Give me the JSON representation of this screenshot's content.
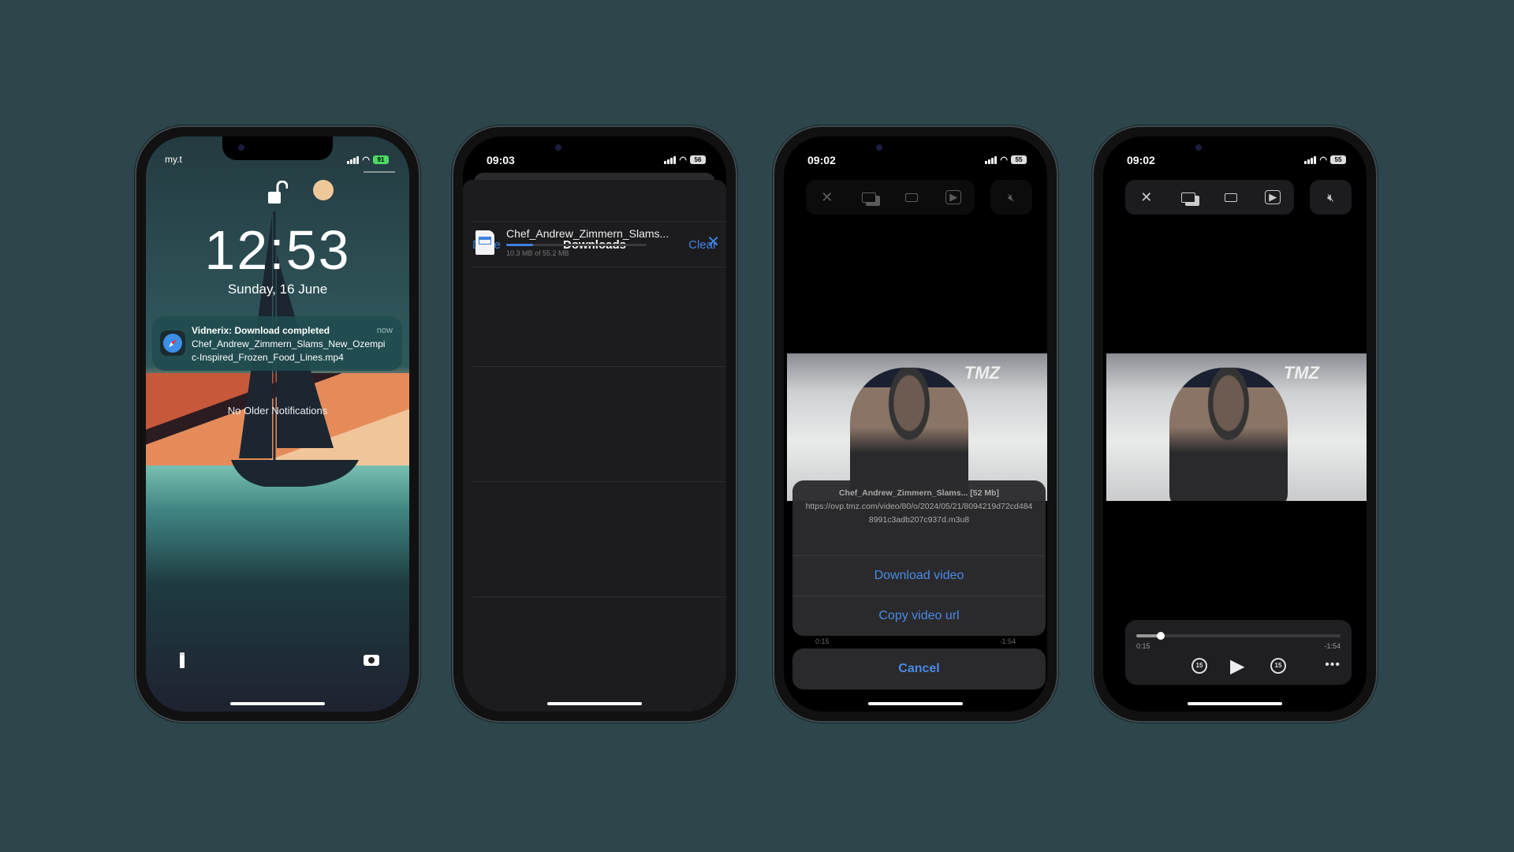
{
  "phone1": {
    "carrier": "my.t",
    "battery": "91",
    "time": "12:53",
    "date": "Sunday, 16 June",
    "notification": {
      "title": "Vidnerix: Download completed",
      "time": "now",
      "body": "Chef_Andrew_Zimmern_Slams_New_Ozempic-Inspired_Frozen_Food_Lines.mp4",
      "icon": "safari-compass-icon"
    },
    "no_older": "No Older Notifications"
  },
  "phone2": {
    "time": "09:03",
    "battery": "56",
    "done": "Done",
    "title": "Downloads",
    "clear": "Clear",
    "item": {
      "name": "Chef_Andrew_Zimmern_Slams...",
      "size": "10.3 MB of 55.2 MB",
      "progress": 0.19
    }
  },
  "phone3": {
    "time": "09:02",
    "battery": "55",
    "video_logo": "TMZ",
    "sheet": {
      "title": "Chef_Andrew_Zimmern_Slams... [52 Mb]",
      "url": "https://ovp.tmz.com/video/80/o/2024/05/21/8094219d72cd4848991c3adb207c937d.m3u8",
      "download": "Download video",
      "copy": "Copy video url",
      "cancel": "Cancel"
    },
    "behind_elapsed": "0:15",
    "behind_remaining": "-1:54"
  },
  "phone4": {
    "time": "09:02",
    "battery": "55",
    "video_logo": "TMZ",
    "elapsed": "0:15",
    "remaining": "-1:54",
    "progress": 0.12,
    "skip_back": "15",
    "skip_fwd": "15"
  },
  "colors": {
    "background": "#2c464c",
    "accent": "#3f82e0"
  }
}
